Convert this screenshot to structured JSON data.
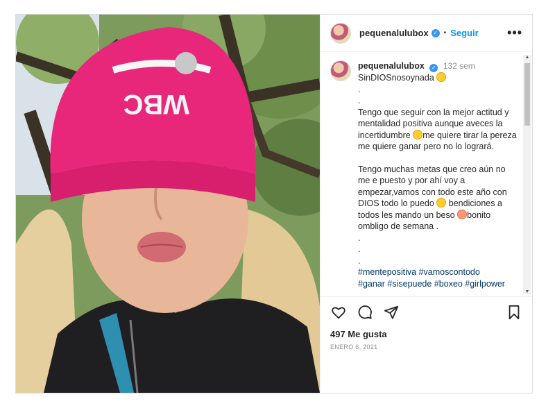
{
  "post": {
    "username": "pequenalulubox",
    "follow_label": "Seguir",
    "separator": "•",
    "more_label": "•••",
    "time_ago": "132 sem",
    "caption_lines": [
      "SinDIOSnosoynada",
      ".",
      ".",
      "Tengo que seguir con la mejor actitud y mentalidad positiva aunque aveces la incertidumbre",
      "me quiere tirar la pereza me quiere ganar pero no lo logrará.",
      "Tengo muchas metas que creo aún no me e puesto y por ahí voy a empezar,vamos con todo este año con DIOS todo lo puedo",
      "bendiciones a todos les mando un beso",
      "bonito ombligo de semana .",
      ".",
      ".",
      "."
    ],
    "hashtags_line1": "#mentepositiva #vamoscontodo",
    "hashtags_line2": "#ganar #sisepuede #boxeo #girlpower",
    "likes": "497 Me gusta",
    "date": "ENERO 6, 2021"
  },
  "photo": {
    "hat_text": "WBC"
  },
  "colors": {
    "accent": "#0095f6",
    "verified": "#3897f0",
    "hat": "#e8267a",
    "hashtag": "#00376b"
  },
  "icons": [
    "heart-icon",
    "comment-icon",
    "share-icon",
    "bookmark-icon",
    "verified-icon",
    "more-icon"
  ]
}
